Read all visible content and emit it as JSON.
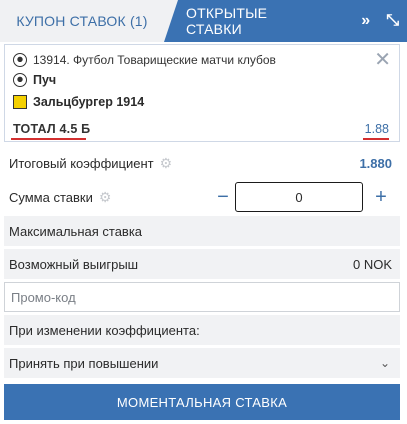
{
  "tabs": {
    "coupon": "КУПОН СТАВОК (1)",
    "open_bets": "ОТКРЫТЫЕ СТАВКИ",
    "icons": [
      "forward-icon",
      "collapse-icon"
    ]
  },
  "coupon": {
    "event": "13914. Футбол Товарищеские матчи клубов",
    "team1": "Пуч",
    "team2": "Зальцбургер 1914",
    "bet_type": "ТОТАЛ 4.5 Б",
    "odds": "1.88"
  },
  "summary": {
    "total_coef_label": "Итоговый коэффициент",
    "total_coef_value": "1.880",
    "stake_label": "Сумма ставки",
    "stake_value": "0",
    "minus": "−",
    "plus": "+",
    "max_stake_label": "Максимальная ставка",
    "possible_win_label": "Возможный выигрыш",
    "possible_win_value": "0 NOK",
    "promo_placeholder": "Промо-код",
    "on_change_label": "При изменении коэффициента:",
    "accept_option": "Принять при повышении",
    "cta_label": "МОМЕНТАЛЬНАЯ СТАВКА"
  },
  "colors": {
    "accent": "#3a72b3",
    "underline": "#d32f2f"
  }
}
